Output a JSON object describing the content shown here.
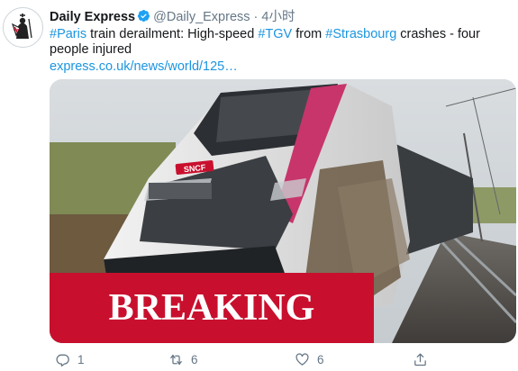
{
  "tweet": {
    "author": {
      "display_name": "Daily Express",
      "handle": "@Daily_Express",
      "verified": true,
      "avatar_icon": "daily-express-crusader-logo"
    },
    "time": "4小时",
    "separator": "·",
    "text": {
      "hashtag1": "#Paris",
      "part1": " train derailment: High-speed ",
      "hashtag2": "#TGV",
      "part2": " from ",
      "hashtag3": "#Strasbourg",
      "part3": " crashes - four people injured"
    },
    "link_text": "express.co.uk/news/world/125…",
    "media": {
      "banner_text": "BREAKING",
      "train_logo_text": "SNCF",
      "banner_color": "#c8102e"
    },
    "actions": {
      "reply_count": "1",
      "retweet_count": "6",
      "like_count": "6"
    }
  },
  "colors": {
    "link": "#1b95e0",
    "secondary_text": "#657786",
    "verified": "#1da1f2"
  }
}
